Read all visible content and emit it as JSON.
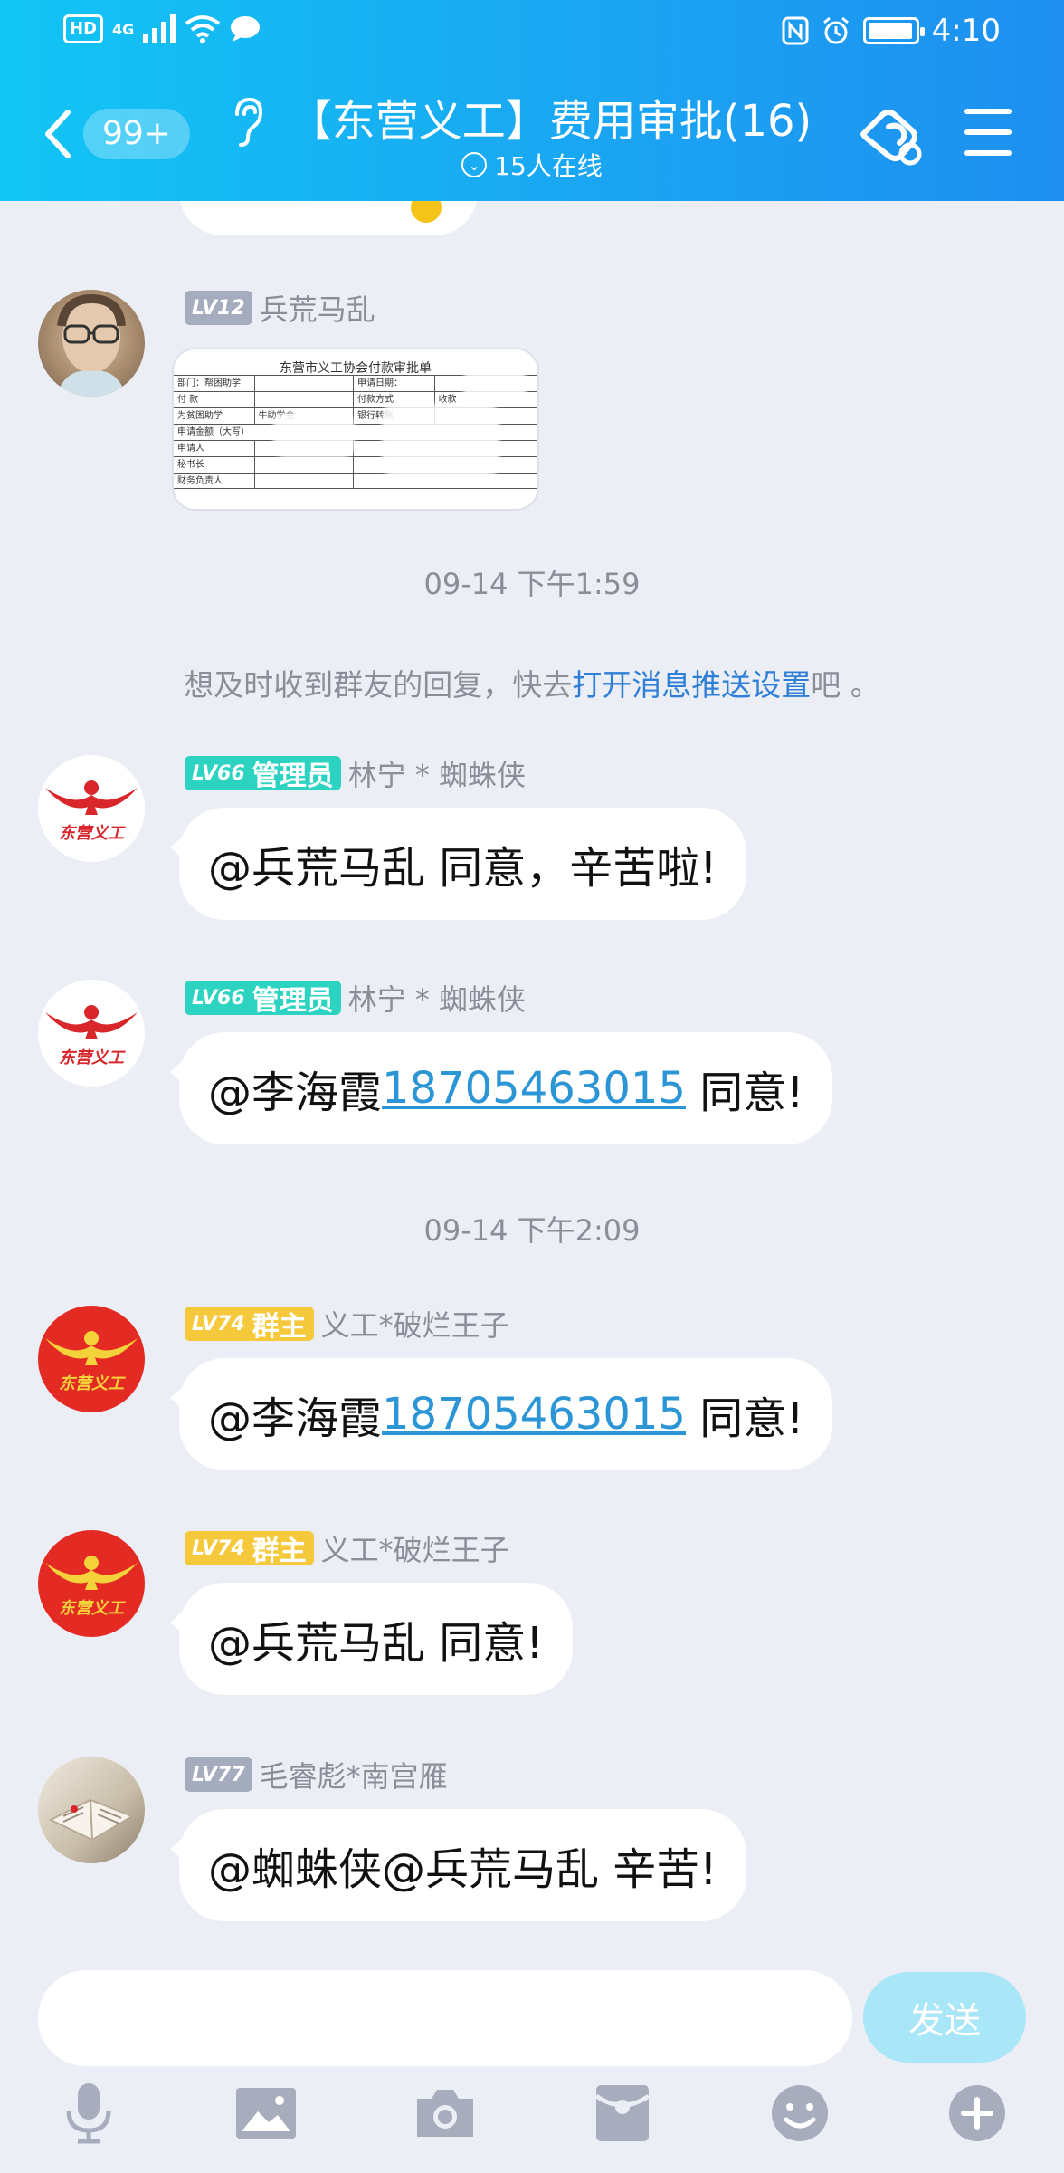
{
  "status_bar": {
    "hd": "HD",
    "network": "4G",
    "time": "4:10"
  },
  "nav": {
    "unread_count": "99+",
    "title": "【东营义工】费用审批(16)",
    "online": "15人在线"
  },
  "image_message": {
    "form_title": "东营市义工协会付款审批单",
    "rows": [
      [
        "部门：帮困助学",
        "",
        "申请日期：",
        ""
      ],
      [
        "付 款",
        "",
        "付款方式",
        "收款"
      ],
      [
        "为贫困助学",
        "牛助学金",
        "银行转账",
        ""
      ],
      [
        "申请金额（大写）",
        "",
        "",
        ""
      ],
      [
        "申请人",
        "",
        "",
        ""
      ],
      [
        "秘书长",
        "",
        "",
        ""
      ],
      [
        "财务负责人",
        "",
        "",
        ""
      ]
    ]
  },
  "timestamps": [
    "09-14 下午1:59",
    "09-14 下午2:09"
  ],
  "system_notice": {
    "prefix": "想及时收到群友的回复，快去",
    "link": "打开消息推送设置",
    "suffix": "吧 。"
  },
  "messages": [
    {
      "level": "LV12",
      "role": "",
      "nick": "兵荒马乱"
    },
    {
      "level": "LV66",
      "role": "管理员",
      "nick": "林宁 * 蜘蛛侠",
      "text": "@兵荒马乱 同意，辛苦啦!"
    },
    {
      "level": "LV66",
      "role": "管理员",
      "nick": "林宁 * 蜘蛛侠",
      "text_prefix": "@李海霞",
      "phone": "18705463015",
      "text_suffix": " 同意!"
    },
    {
      "level": "LV74",
      "role": "群主",
      "nick": "义工*破烂王子",
      "text_prefix": "@李海霞",
      "phone": "18705463015",
      "text_suffix": " 同意!"
    },
    {
      "level": "LV74",
      "role": "群主",
      "nick": "义工*破烂王子",
      "text": "@兵荒马乱 同意!"
    },
    {
      "level": "LV77",
      "role": "",
      "nick": "毛睿彪*南宫雁",
      "text": "@蜘蛛侠@兵荒马乱 辛苦!"
    }
  ],
  "logo_text": "东营义工",
  "input": {
    "value": "",
    "placeholder": "",
    "send_label": "发送"
  },
  "toolbar_icons": [
    "microphone-icon",
    "image-icon",
    "camera-icon",
    "red-packet-icon",
    "emoji-icon",
    "plus-icon"
  ],
  "colors": {
    "header_start": "#12c5f4",
    "header_end": "#1e8ff0",
    "admin_badge": "#2dd3c1",
    "owner_badge": "#f6c93c",
    "level_badge": "#a5acbd",
    "link": "#2b95d6",
    "send_button": "#a9e6f7"
  }
}
